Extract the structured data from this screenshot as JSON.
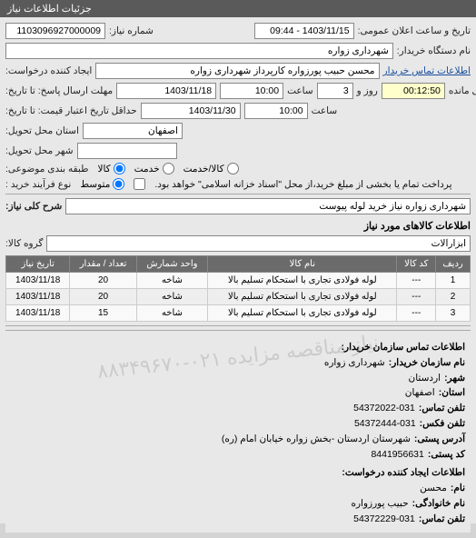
{
  "header": {
    "title": "جزئیات اطلاعات نیاز"
  },
  "fields": {
    "req_no_label": "شماره نیاز:",
    "req_no": "1103096927000009",
    "pub_datetime_label": "تاریخ و ساعت اعلان عمومی:",
    "pub_datetime": "1403/11/15 - 09:44",
    "buyer_org_label": "نام دستگاه خریدار:",
    "buyer_org": "شهرداری زواره",
    "creator_label": "ایجاد کننده درخواست:",
    "creator": "محسن حبیب پورزواره کارپرداز شهرداری زواره",
    "buyer_contact_link": "اطلاعات تماس خریدار",
    "resp_deadline_label": "مهلت ارسال پاسخ: تا تاریخ:",
    "resp_date": "1403/11/18",
    "time_label": "ساعت",
    "resp_time": "10:00",
    "days_left": "3",
    "days_and_label": "روز و",
    "time_left": "00:12:50",
    "time_left_label": "ساعت باقی مانده",
    "acc_price_label": "حداقل تاریخ اعتبار قیمت: تا تاریخ:",
    "acc_date": "1403/11/30",
    "acc_time": "10:00",
    "province_label": "استان محل تحویل:",
    "province": "اصفهان",
    "city_label": "شهر محل تحویل:",
    "city": "",
    "subject_class_label": "طبقه بندی موضوعی:",
    "goods": "کالا",
    "service": "خدمت",
    "goods_service": "کالا/خدمت",
    "proc_type_label": "نوع فرآیند خرید :",
    "mid": "متوسط",
    "proc_note": "پرداخت تمام یا بخشی از مبلغ خرید،از محل \"اسناد خزانه اسلامی\" خواهد بود.",
    "need_desc_label": "شرح کلی نیاز:",
    "need_desc": "شهرداری زواره نیاز خرید لوله پیوست"
  },
  "goods_section": {
    "title": "اطلاعات کالاهای مورد نیاز",
    "group_label": "گروه کالا:",
    "group_value": "ابزارآلات"
  },
  "goods_table": {
    "headers": {
      "row": "ردیف",
      "code": "کد کالا",
      "name": "نام کالا",
      "unit": "واحد شمارش",
      "qty": "تعداد / مقدار",
      "need_date": "تاریخ نیاز"
    },
    "rows": [
      {
        "row": "1",
        "code": "---",
        "name": "لوله فولادی تجاری با استحکام تسلیم بالا",
        "unit": "شاخه",
        "qty": "20",
        "need_date": "1403/11/18"
      },
      {
        "row": "2",
        "code": "---",
        "name": "لوله فولادی تجاری با استحکام تسلیم بالا",
        "unit": "شاخه",
        "qty": "20",
        "need_date": "1403/11/18"
      },
      {
        "row": "3",
        "code": "---",
        "name": "لوله فولادی تجاری با استحکام تسلیم بالا",
        "unit": "شاخه",
        "qty": "15",
        "need_date": "1403/11/18"
      }
    ]
  },
  "contact": {
    "section1_title": "اطلاعات تماس سازمان خریدار:",
    "org_name_label": "نام سازمان خریدار:",
    "org_name": "شهرداری زواره",
    "city_label": "شهر:",
    "city": "اردستان",
    "province_label": "استان:",
    "province": "اصفهان",
    "phone_label": "تلفن تماس:",
    "phone": "54372022-031",
    "fax_label": "تلفن فکس:",
    "fax": "54372444-031",
    "postal_addr_label": "آدرس پستی:",
    "postal_addr": "شهرستان اردستان -بخش زواره خیابان امام (ره)",
    "postal_code_label": "کد پستی:",
    "postal_code": "8441956631",
    "section2_title": "اطلاعات ایجاد کننده درخواست:",
    "fname_label": "نام:",
    "fname": "محسن",
    "lname_label": "نام خانوادگی:",
    "lname": "حبیب پورزواره",
    "creator_phone_label": "تلفن تماس:",
    "creator_phone": "54372229-031"
  },
  "watermark": "نیاز مناقصه مزایده\n۰۲۱-۸۸۳۴۹۶۷۰"
}
